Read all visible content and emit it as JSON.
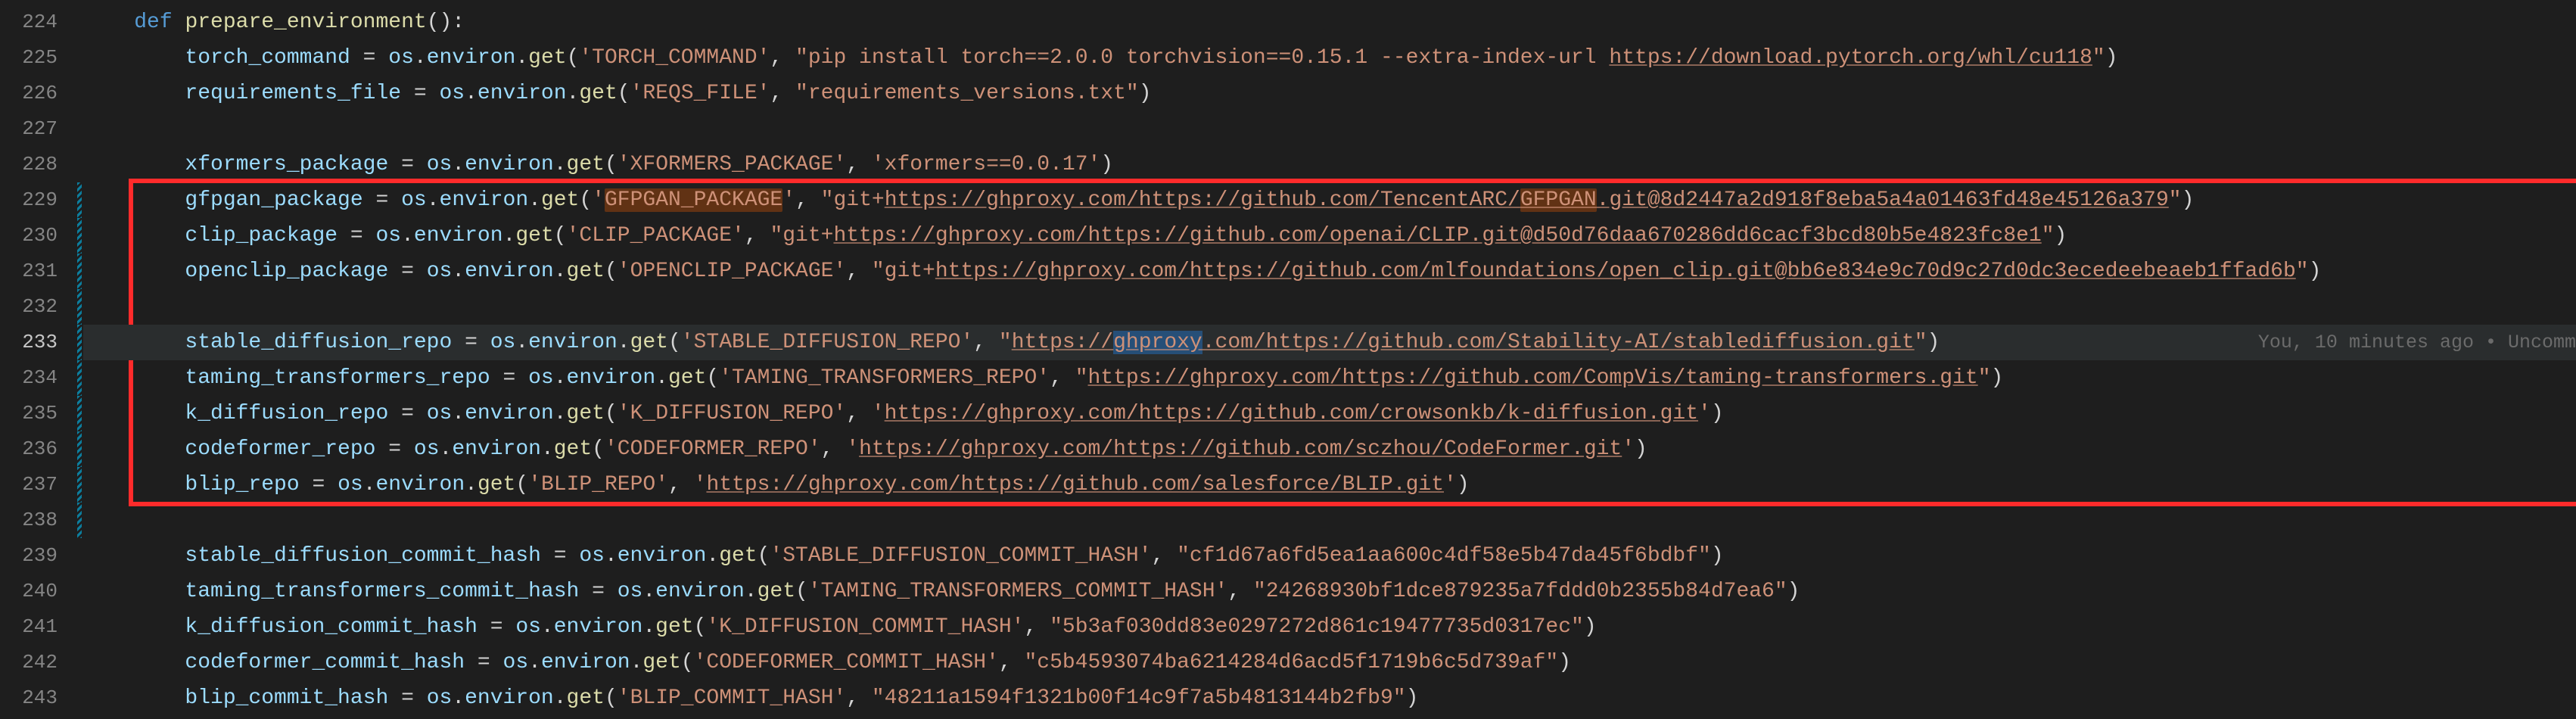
{
  "gutter": {
    "start": 224,
    "end": 243,
    "active": 233
  },
  "modified_lines": [
    229,
    230,
    231,
    232,
    233,
    234,
    235,
    236,
    237,
    238
  ],
  "code_lens": "You, 10 minutes ago • Uncomm",
  "lines": {
    "224": {
      "indent": "    ",
      "tokens": [
        {
          "t": "def ",
          "c": "kw"
        },
        {
          "t": "prepare_environment",
          "c": "fn"
        },
        {
          "t": "():",
          "c": "punc"
        }
      ]
    },
    "225": {
      "indent": "        ",
      "tokens": [
        {
          "t": "torch_command",
          "c": "var"
        },
        {
          "t": " = ",
          "c": "op"
        },
        {
          "t": "os",
          "c": "var"
        },
        {
          "t": ".",
          "c": "punc"
        },
        {
          "t": "environ",
          "c": "var"
        },
        {
          "t": ".",
          "c": "punc"
        },
        {
          "t": "get",
          "c": "fn"
        },
        {
          "t": "(",
          "c": "punc"
        },
        {
          "t": "'TORCH_COMMAND'",
          "c": "str"
        },
        {
          "t": ", ",
          "c": "punc"
        },
        {
          "t": "\"pip install torch==2.0.0 torchvision==0.15.1 --extra-index-url ",
          "c": "str"
        },
        {
          "t": "https://download.pytorch.org/whl/cu118",
          "c": "str und"
        },
        {
          "t": "\"",
          "c": "str"
        },
        {
          "t": ")",
          "c": "punc"
        }
      ]
    },
    "226": {
      "indent": "        ",
      "tokens": [
        {
          "t": "requirements_file",
          "c": "var"
        },
        {
          "t": " = ",
          "c": "op"
        },
        {
          "t": "os",
          "c": "var"
        },
        {
          "t": ".",
          "c": "punc"
        },
        {
          "t": "environ",
          "c": "var"
        },
        {
          "t": ".",
          "c": "punc"
        },
        {
          "t": "get",
          "c": "fn"
        },
        {
          "t": "(",
          "c": "punc"
        },
        {
          "t": "'REQS_FILE'",
          "c": "str"
        },
        {
          "t": ", ",
          "c": "punc"
        },
        {
          "t": "\"requirements_versions.txt\"",
          "c": "str"
        },
        {
          "t": ")",
          "c": "punc"
        }
      ]
    },
    "227": {
      "indent": "",
      "tokens": []
    },
    "228": {
      "indent": "        ",
      "tokens": [
        {
          "t": "xformers_package",
          "c": "var"
        },
        {
          "t": " = ",
          "c": "op"
        },
        {
          "t": "os",
          "c": "var"
        },
        {
          "t": ".",
          "c": "punc"
        },
        {
          "t": "environ",
          "c": "var"
        },
        {
          "t": ".",
          "c": "punc"
        },
        {
          "t": "get",
          "c": "fn"
        },
        {
          "t": "(",
          "c": "punc"
        },
        {
          "t": "'XFORMERS_PACKAGE'",
          "c": "str"
        },
        {
          "t": ", ",
          "c": "punc"
        },
        {
          "t": "'xformers==0.0.17'",
          "c": "str"
        },
        {
          "t": ")",
          "c": "punc"
        }
      ]
    },
    "229": {
      "indent": "        ",
      "tokens": [
        {
          "t": "gfpgan_package",
          "c": "var"
        },
        {
          "t": " = ",
          "c": "op"
        },
        {
          "t": "os",
          "c": "var"
        },
        {
          "t": ".",
          "c": "punc"
        },
        {
          "t": "environ",
          "c": "var"
        },
        {
          "t": ".",
          "c": "punc"
        },
        {
          "t": "get",
          "c": "fn"
        },
        {
          "t": "(",
          "c": "punc"
        },
        {
          "t": "'",
          "c": "str"
        },
        {
          "t": "GFPGAN_PACKAGE",
          "c": "str hl"
        },
        {
          "t": "'",
          "c": "str"
        },
        {
          "t": ", ",
          "c": "punc"
        },
        {
          "t": "\"git+",
          "c": "str"
        },
        {
          "t": "https://ghproxy.com/https://github.com/TencentARC/",
          "c": "str und"
        },
        {
          "t": "GFPGAN",
          "c": "str und hl"
        },
        {
          "t": ".git@8d2447a2d918f8eba5a4a01463fd48e45126a379",
          "c": "str und"
        },
        {
          "t": "\"",
          "c": "str"
        },
        {
          "t": ")",
          "c": "punc"
        }
      ]
    },
    "230": {
      "indent": "        ",
      "tokens": [
        {
          "t": "clip_package",
          "c": "var"
        },
        {
          "t": " = ",
          "c": "op"
        },
        {
          "t": "os",
          "c": "var"
        },
        {
          "t": ".",
          "c": "punc"
        },
        {
          "t": "environ",
          "c": "var"
        },
        {
          "t": ".",
          "c": "punc"
        },
        {
          "t": "get",
          "c": "fn"
        },
        {
          "t": "(",
          "c": "punc"
        },
        {
          "t": "'CLIP_PACKAGE'",
          "c": "str"
        },
        {
          "t": ", ",
          "c": "punc"
        },
        {
          "t": "\"git+",
          "c": "str"
        },
        {
          "t": "https://ghproxy.com/https://github.com/openai/CLIP.git@d50d76daa670286dd6cacf3bcd80b5e4823fc8e1",
          "c": "str und"
        },
        {
          "t": "\"",
          "c": "str"
        },
        {
          "t": ")",
          "c": "punc"
        }
      ]
    },
    "231": {
      "indent": "        ",
      "tokens": [
        {
          "t": "openclip_package",
          "c": "var"
        },
        {
          "t": " = ",
          "c": "op"
        },
        {
          "t": "os",
          "c": "var"
        },
        {
          "t": ".",
          "c": "punc"
        },
        {
          "t": "environ",
          "c": "var"
        },
        {
          "t": ".",
          "c": "punc"
        },
        {
          "t": "get",
          "c": "fn"
        },
        {
          "t": "(",
          "c": "punc"
        },
        {
          "t": "'OPENCLIP_PACKAGE'",
          "c": "str"
        },
        {
          "t": ", ",
          "c": "punc"
        },
        {
          "t": "\"git+",
          "c": "str"
        },
        {
          "t": "https://ghproxy.com/https://github.com/mlfoundations/open_clip.git@bb6e834e9c70d9c27d0dc3ecedeebeaeb1ffad6b",
          "c": "str und"
        },
        {
          "t": "\"",
          "c": "str"
        },
        {
          "t": ")",
          "c": "punc"
        }
      ]
    },
    "232": {
      "indent": "",
      "tokens": []
    },
    "233": {
      "indent": "        ",
      "tokens": [
        {
          "t": "stable_diffusion_repo",
          "c": "var"
        },
        {
          "t": " = ",
          "c": "op"
        },
        {
          "t": "os",
          "c": "var"
        },
        {
          "t": ".",
          "c": "punc"
        },
        {
          "t": "environ",
          "c": "var"
        },
        {
          "t": ".",
          "c": "punc"
        },
        {
          "t": "get",
          "c": "fn"
        },
        {
          "t": "(",
          "c": "punc"
        },
        {
          "t": "'STABLE_DIFFUSION_REPO'",
          "c": "str"
        },
        {
          "t": ", ",
          "c": "punc"
        },
        {
          "t": "\"",
          "c": "str"
        },
        {
          "t": "https://",
          "c": "str und"
        },
        {
          "t": "ghproxy",
          "c": "str und sel"
        },
        {
          "t": ".com/https://github.com/Stability-AI/stablediffusion.git",
          "c": "str und"
        },
        {
          "t": "\"",
          "c": "str"
        },
        {
          "t": ")",
          "c": "punc"
        }
      ]
    },
    "234": {
      "indent": "        ",
      "tokens": [
        {
          "t": "taming_transformers_repo",
          "c": "var"
        },
        {
          "t": " = ",
          "c": "op"
        },
        {
          "t": "os",
          "c": "var"
        },
        {
          "t": ".",
          "c": "punc"
        },
        {
          "t": "environ",
          "c": "var"
        },
        {
          "t": ".",
          "c": "punc"
        },
        {
          "t": "get",
          "c": "fn"
        },
        {
          "t": "(",
          "c": "punc"
        },
        {
          "t": "'TAMING_TRANSFORMERS_REPO'",
          "c": "str"
        },
        {
          "t": ", ",
          "c": "punc"
        },
        {
          "t": "\"",
          "c": "str"
        },
        {
          "t": "https://ghproxy.com/https://github.com/CompVis/taming-transformers.git",
          "c": "str und"
        },
        {
          "t": "\"",
          "c": "str"
        },
        {
          "t": ")",
          "c": "punc"
        }
      ]
    },
    "235": {
      "indent": "        ",
      "tokens": [
        {
          "t": "k_diffusion_repo",
          "c": "var"
        },
        {
          "t": " = ",
          "c": "op"
        },
        {
          "t": "os",
          "c": "var"
        },
        {
          "t": ".",
          "c": "punc"
        },
        {
          "t": "environ",
          "c": "var"
        },
        {
          "t": ".",
          "c": "punc"
        },
        {
          "t": "get",
          "c": "fn"
        },
        {
          "t": "(",
          "c": "punc"
        },
        {
          "t": "'K_DIFFUSION_REPO'",
          "c": "str"
        },
        {
          "t": ", ",
          "c": "punc"
        },
        {
          "t": "'",
          "c": "str"
        },
        {
          "t": "https://ghproxy.com/https://github.com/crowsonkb/k-diffusion.git",
          "c": "str und"
        },
        {
          "t": "'",
          "c": "str"
        },
        {
          "t": ")",
          "c": "punc"
        }
      ]
    },
    "236": {
      "indent": "        ",
      "tokens": [
        {
          "t": "codeformer_repo",
          "c": "var"
        },
        {
          "t": " = ",
          "c": "op"
        },
        {
          "t": "os",
          "c": "var"
        },
        {
          "t": ".",
          "c": "punc"
        },
        {
          "t": "environ",
          "c": "var"
        },
        {
          "t": ".",
          "c": "punc"
        },
        {
          "t": "get",
          "c": "fn"
        },
        {
          "t": "(",
          "c": "punc"
        },
        {
          "t": "'CODEFORMER_REPO'",
          "c": "str"
        },
        {
          "t": ", ",
          "c": "punc"
        },
        {
          "t": "'",
          "c": "str"
        },
        {
          "t": "https://ghproxy.com/https://github.com/sczhou/CodeFormer.git",
          "c": "str und"
        },
        {
          "t": "'",
          "c": "str"
        },
        {
          "t": ")",
          "c": "punc"
        }
      ]
    },
    "237": {
      "indent": "        ",
      "tokens": [
        {
          "t": "blip_repo",
          "c": "var"
        },
        {
          "t": " = ",
          "c": "op"
        },
        {
          "t": "os",
          "c": "var"
        },
        {
          "t": ".",
          "c": "punc"
        },
        {
          "t": "environ",
          "c": "var"
        },
        {
          "t": ".",
          "c": "punc"
        },
        {
          "t": "get",
          "c": "fn"
        },
        {
          "t": "(",
          "c": "punc"
        },
        {
          "t": "'BLIP_REPO'",
          "c": "str"
        },
        {
          "t": ", ",
          "c": "punc"
        },
        {
          "t": "'",
          "c": "str"
        },
        {
          "t": "https://ghproxy.com/https://github.com/salesforce/BLIP.git",
          "c": "str und"
        },
        {
          "t": "'",
          "c": "str"
        },
        {
          "t": ")",
          "c": "punc"
        }
      ]
    },
    "238": {
      "indent": "",
      "tokens": []
    },
    "239": {
      "indent": "        ",
      "tokens": [
        {
          "t": "stable_diffusion_commit_hash",
          "c": "var"
        },
        {
          "t": " = ",
          "c": "op"
        },
        {
          "t": "os",
          "c": "var"
        },
        {
          "t": ".",
          "c": "punc"
        },
        {
          "t": "environ",
          "c": "var"
        },
        {
          "t": ".",
          "c": "punc"
        },
        {
          "t": "get",
          "c": "fn"
        },
        {
          "t": "(",
          "c": "punc"
        },
        {
          "t": "'STABLE_DIFFUSION_COMMIT_HASH'",
          "c": "str"
        },
        {
          "t": ", ",
          "c": "punc"
        },
        {
          "t": "\"cf1d67a6fd5ea1aa600c4df58e5b47da45f6bdbf\"",
          "c": "str"
        },
        {
          "t": ")",
          "c": "punc"
        }
      ]
    },
    "240": {
      "indent": "        ",
      "tokens": [
        {
          "t": "taming_transformers_commit_hash",
          "c": "var"
        },
        {
          "t": " = ",
          "c": "op"
        },
        {
          "t": "os",
          "c": "var"
        },
        {
          "t": ".",
          "c": "punc"
        },
        {
          "t": "environ",
          "c": "var"
        },
        {
          "t": ".",
          "c": "punc"
        },
        {
          "t": "get",
          "c": "fn"
        },
        {
          "t": "(",
          "c": "punc"
        },
        {
          "t": "'TAMING_TRANSFORMERS_COMMIT_HASH'",
          "c": "str"
        },
        {
          "t": ", ",
          "c": "punc"
        },
        {
          "t": "\"24268930bf1dce879235a7fddd0b2355b84d7ea6\"",
          "c": "str"
        },
        {
          "t": ")",
          "c": "punc"
        }
      ]
    },
    "241": {
      "indent": "        ",
      "tokens": [
        {
          "t": "k_diffusion_commit_hash",
          "c": "var"
        },
        {
          "t": " = ",
          "c": "op"
        },
        {
          "t": "os",
          "c": "var"
        },
        {
          "t": ".",
          "c": "punc"
        },
        {
          "t": "environ",
          "c": "var"
        },
        {
          "t": ".",
          "c": "punc"
        },
        {
          "t": "get",
          "c": "fn"
        },
        {
          "t": "(",
          "c": "punc"
        },
        {
          "t": "'K_DIFFUSION_COMMIT_HASH'",
          "c": "str"
        },
        {
          "t": ", ",
          "c": "punc"
        },
        {
          "t": "\"5b3af030dd83e0297272d861c19477735d0317ec\"",
          "c": "str"
        },
        {
          "t": ")",
          "c": "punc"
        }
      ]
    },
    "242": {
      "indent": "        ",
      "tokens": [
        {
          "t": "codeformer_commit_hash",
          "c": "var"
        },
        {
          "t": " = ",
          "c": "op"
        },
        {
          "t": "os",
          "c": "var"
        },
        {
          "t": ".",
          "c": "punc"
        },
        {
          "t": "environ",
          "c": "var"
        },
        {
          "t": ".",
          "c": "punc"
        },
        {
          "t": "get",
          "c": "fn"
        },
        {
          "t": "(",
          "c": "punc"
        },
        {
          "t": "'CODEFORMER_COMMIT_HASH'",
          "c": "str"
        },
        {
          "t": ", ",
          "c": "punc"
        },
        {
          "t": "\"c5b4593074ba6214284d6acd5f1719b6c5d739af\"",
          "c": "str"
        },
        {
          "t": ")",
          "c": "punc"
        }
      ]
    },
    "243": {
      "indent": "        ",
      "tokens": [
        {
          "t": "blip_commit_hash",
          "c": "var"
        },
        {
          "t": " = ",
          "c": "op"
        },
        {
          "t": "os",
          "c": "var"
        },
        {
          "t": ".",
          "c": "punc"
        },
        {
          "t": "environ",
          "c": "var"
        },
        {
          "t": ".",
          "c": "punc"
        },
        {
          "t": "get",
          "c": "fn"
        },
        {
          "t": "(",
          "c": "punc"
        },
        {
          "t": "'BLIP_COMMIT_HASH'",
          "c": "str"
        },
        {
          "t": ", ",
          "c": "punc"
        },
        {
          "t": "\"48211a1594f1321b00f14c9f7a5b4813144b2fb9\"",
          "c": "str"
        },
        {
          "t": ")",
          "c": "punc"
        }
      ]
    }
  }
}
